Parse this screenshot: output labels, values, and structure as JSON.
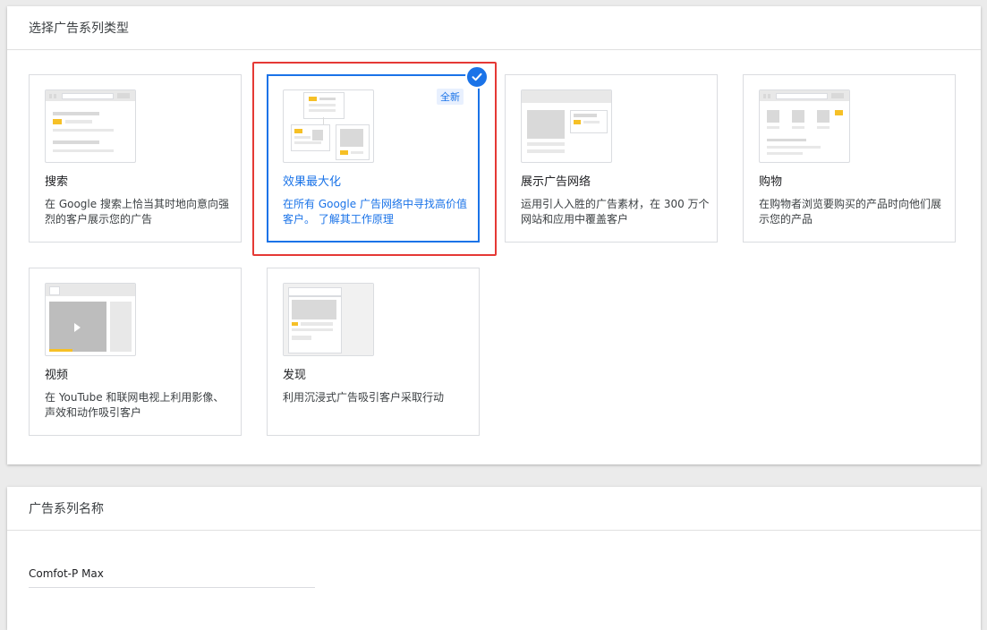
{
  "campaign_type_section": {
    "title": "选择广告系列类型",
    "cards": [
      {
        "id": "search",
        "title": "搜索",
        "desc": "在 Google 搜索上恰当其时地向意向强烈的客户展示您的广告"
      },
      {
        "id": "pmax",
        "title": "效果最大化",
        "desc": "在所有 Google 广告网络中寻找高价值客户。 了解其工作原理",
        "badge": "全新",
        "selected": true
      },
      {
        "id": "display",
        "title": "展示广告网络",
        "desc": "运用引人入胜的广告素材，在 300 万个网站和应用中覆盖客户"
      },
      {
        "id": "shopping",
        "title": "购物",
        "desc": "在购物者浏览要购买的产品时向他们展示您的产品"
      },
      {
        "id": "video",
        "title": "视频",
        "desc": "在 YouTube 和联网电视上利用影像、声效和动作吸引客户"
      },
      {
        "id": "discovery",
        "title": "发现",
        "desc": "利用沉浸式广告吸引客户采取行动"
      }
    ]
  },
  "campaign_name_section": {
    "title": "广告系列名称",
    "value": "Comfot-P Max"
  },
  "colors": {
    "accent": "#1a73e8",
    "highlight": "#e53935",
    "thumb_yellow": "#f6c026"
  },
  "icons": {
    "selected": "check-circle-icon",
    "play": "play-icon"
  }
}
